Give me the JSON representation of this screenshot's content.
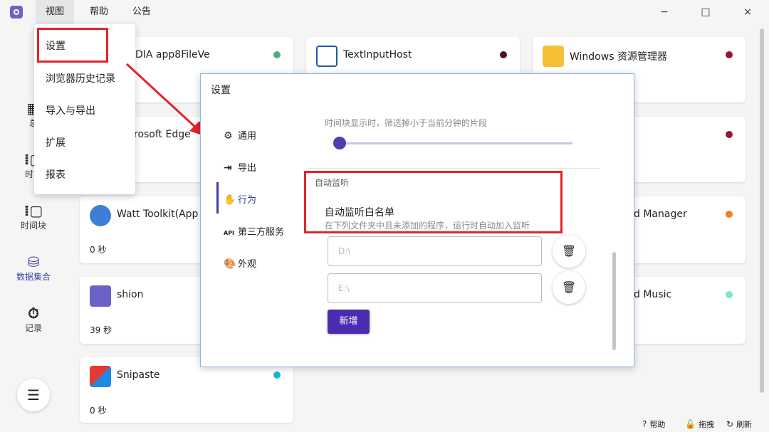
{
  "menubar": {
    "items": [
      "视图",
      "帮助",
      "公告"
    ],
    "window_controls": {
      "minimize": "−",
      "maximize": "□",
      "close": "×"
    }
  },
  "sidebar": {
    "items": [
      {
        "label": "总",
        "icon": "grid-icon"
      },
      {
        "label": "时间",
        "icon": "timeline-icon"
      },
      {
        "label": "时间块",
        "icon": "time-block-icon"
      },
      {
        "label": "数据集合",
        "icon": "database-icon",
        "active": true
      },
      {
        "label": "记录",
        "icon": "stopwatch-icon"
      }
    ],
    "menu_button_icon": "hamburger-icon"
  },
  "dropdown": {
    "items": [
      "设置",
      "浏览器历史记录",
      "导入与导出",
      "扩展",
      "报表"
    ],
    "highlighted": "设置"
  },
  "cards": [
    {
      "name": "DIA app8FileVe",
      "dot_color": "#4caf7d"
    },
    {
      "name": "TextInputHost",
      "dot_color": "#4a1230"
    },
    {
      "name": "Windows 资源管理器",
      "dot_color": "#a01030"
    },
    {
      "name": "rosoft Edge",
      "dot_color": ""
    },
    {
      "name": "",
      "dot_color": "#a01030"
    },
    {
      "name": "Watt Toolkit(App",
      "time": "0 秒"
    },
    {
      "name": "d Manager",
      "dot_color": "#f0801a"
    },
    {
      "name": "shion",
      "time": "39 秒"
    },
    {
      "name": "d Music",
      "dot_color": "#7ee8b8"
    },
    {
      "name": "Snipaste",
      "dot_color": "#1ab8c8",
      "time": "0 秒"
    }
  ],
  "settings_dialog": {
    "title": "设置",
    "tabs": [
      {
        "label": "通用",
        "icon": "gear-icon"
      },
      {
        "label": "导出",
        "icon": "export-icon"
      },
      {
        "label": "行为",
        "icon": "hand-icon",
        "active": true
      },
      {
        "label": "第三方服务",
        "icon": "api-icon",
        "icon_text": "API"
      },
      {
        "label": "外观",
        "icon": "palette-icon"
      }
    ],
    "slider_desc": "时间块显示时，筛选掉小于当前分钟的片段",
    "slider_value": 0,
    "section_label": "自动监听",
    "whitelist_title": "自动监听白名单",
    "whitelist_desc": "在下列文件夹中且未添加的程序，运行时自动加入监听",
    "entries": [
      {
        "value": "D:\\"
      },
      {
        "value": "E:\\"
      }
    ],
    "add_label": "新增"
  },
  "bottom_bar": {
    "help": "帮助",
    "drag": "拖拽",
    "refresh": "刷新"
  }
}
